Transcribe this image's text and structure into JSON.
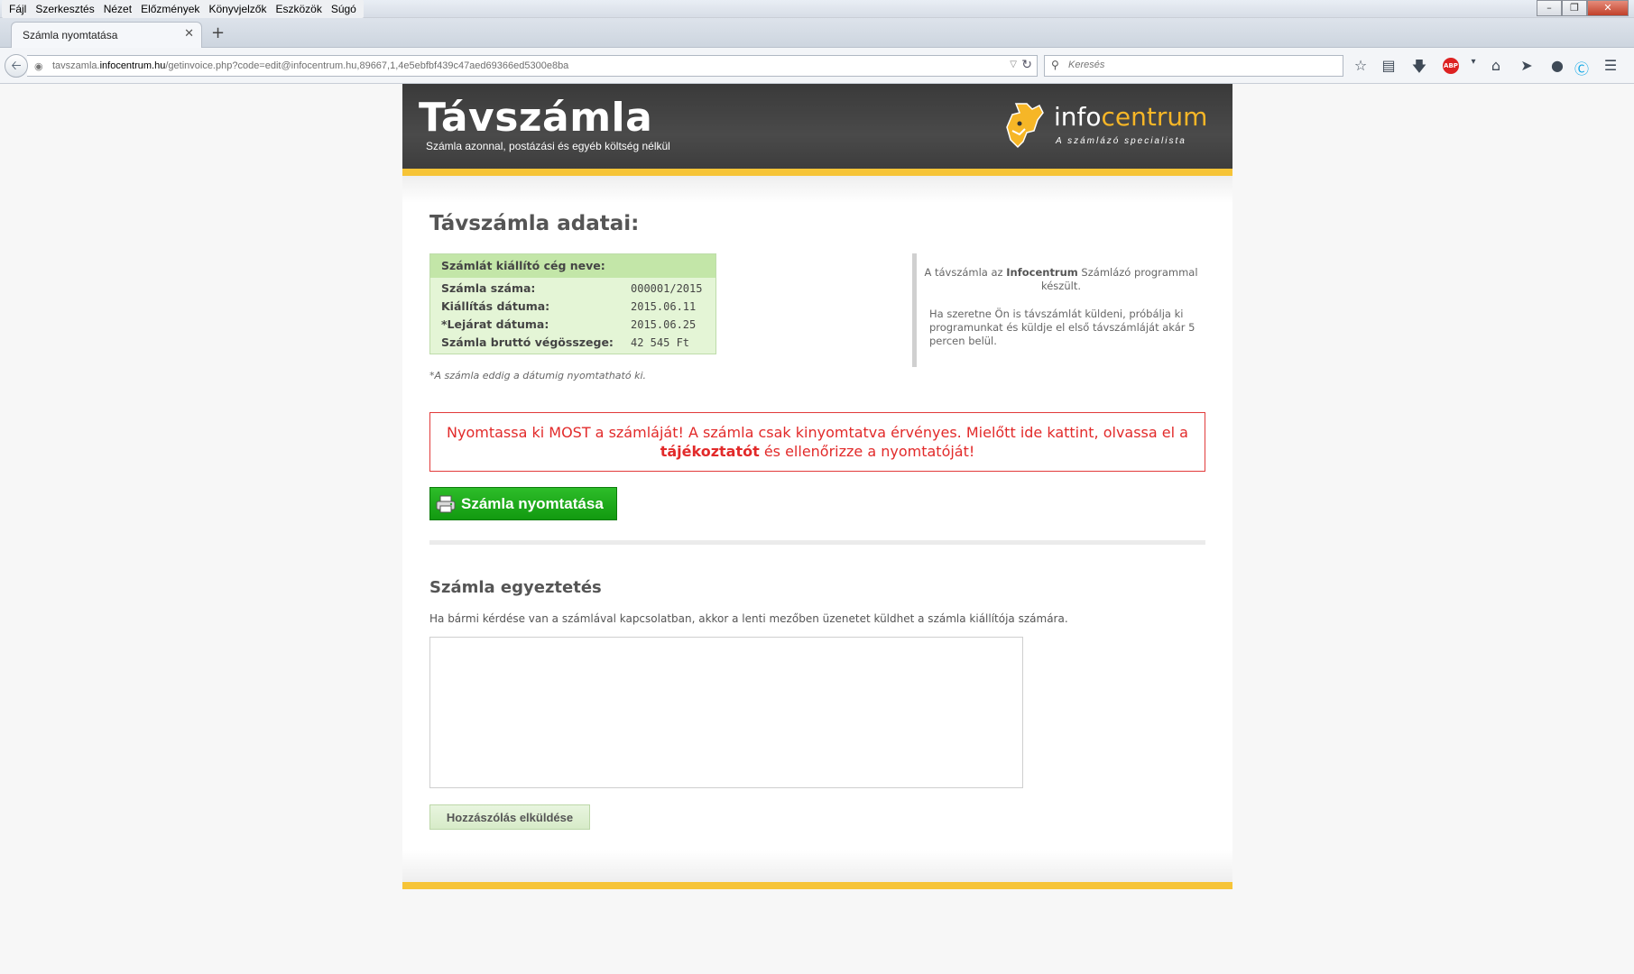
{
  "browser": {
    "menu": [
      "Fájl",
      "Szerkesztés",
      "Nézet",
      "Előzmények",
      "Könyvjelzők",
      "Eszközök",
      "Súgó"
    ],
    "tab_title": "Számla nyomtatása",
    "url_prefix": "tavszamla.",
    "url_domain": "infocentrum.hu",
    "url_path": "/getinvoice.php?code=edit@infocentrum.hu,89667,1,4e5ebfbf439c47aed69366ed5300e8ba",
    "search_placeholder": "Keresés"
  },
  "header": {
    "title": "Távszámla",
    "subtitle": "Számla azonnal, postázási és egyéb költség nélkül",
    "logo_text_a": "info",
    "logo_text_b": "centrum",
    "logo_tagline": "A számlázó specialista",
    "accent": "#f6c437"
  },
  "main": {
    "title": "Távszámla adatai:",
    "info_header": "Számlát kiállító cég neve:",
    "rows": [
      {
        "label": "Számla száma:",
        "value": "000001/2015"
      },
      {
        "label": "Kiállítás dátuma:",
        "value": "2015.06.11"
      },
      {
        "label": "*Lejárat dátuma:",
        "value": "2015.06.25"
      },
      {
        "label": "Számla bruttó végösszege:",
        "value": "42 545 Ft"
      }
    ],
    "note": "*A számla eddig a dátumig nyomtatható ki.",
    "side_p1_a": "A távszámla az ",
    "side_p1_b": "Infocentrum",
    "side_p1_c": " Számlázó programmal készült.",
    "side_p2": "Ha szeretne Ön is távszámlát küldeni, próbálja ki programunkat és küldje el első távszámláját akár 5 percen belül.",
    "alert_a": "Nyomtassa ki MOST a számláját! A számla csak kinyomtatva érvényes. Mielőtt ide kattint, olvassa el a ",
    "alert_link": "tájékoztatót",
    "alert_b": " és ellenőrizze a nyomtatóját!",
    "print_button": "Számla nyomtatása",
    "alert_color": "#e22a2a"
  },
  "reconcile": {
    "title": "Számla egyeztetés",
    "description": "Ha bármi kérdése van a számlával kapcsolatban, akkor a lenti mezőben üzenetet küldhet a számla kiállítója számára.",
    "message_value": "",
    "send_button": "Hozzászólás elküldése"
  }
}
